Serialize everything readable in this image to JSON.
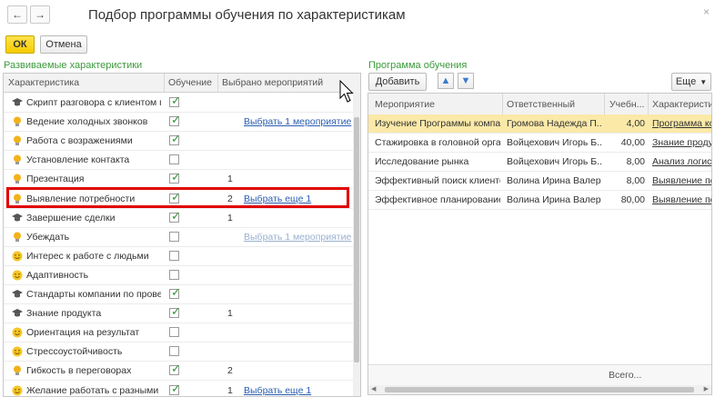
{
  "window": {
    "title": "Подбор программы обучения по характеристикам"
  },
  "toolbar": {
    "ok_label": "ОК",
    "cancel_label": "Отмена"
  },
  "left": {
    "section_title": "Развиваемые характеристики",
    "columns": [
      "Характеристика",
      "Обучение",
      "Выбрано мероприятий"
    ],
    "rows": [
      {
        "icon": "graduation-cap-icon",
        "name": "Скрипт разговора с клиентом п...",
        "training": true,
        "count": "",
        "link": ""
      },
      {
        "icon": "bulb-icon",
        "name": "Ведение холодных звонков",
        "training": true,
        "count": "",
        "link": "Выбрать 1 мероприятие"
      },
      {
        "icon": "bulb-icon",
        "name": "Работа с возражениями",
        "training": true,
        "count": "",
        "link": ""
      },
      {
        "icon": "bulb-icon",
        "name": "Установление контакта",
        "training": false,
        "count": "",
        "link": ""
      },
      {
        "icon": "bulb-icon",
        "name": "Презентация",
        "training": true,
        "count": "1",
        "link": ""
      },
      {
        "icon": "bulb-icon",
        "name": "Выявление потребности",
        "training": true,
        "count": "2",
        "link": "Выбрать еще 1"
      },
      {
        "icon": "graduation-cap-icon",
        "name": "Завершение сделки",
        "training": true,
        "count": "1",
        "link": ""
      },
      {
        "icon": "bulb-icon",
        "name": "Убеждать",
        "training": false,
        "count": "",
        "link": "Выбрать 1 мероприятие"
      },
      {
        "icon": "smiley-icon",
        "name": "Интерес к работе с людьми",
        "training": false,
        "count": "",
        "link": ""
      },
      {
        "icon": "smiley-icon",
        "name": "Адаптивность",
        "training": false,
        "count": "",
        "link": ""
      },
      {
        "icon": "graduation-cap-icon",
        "name": "Стандарты компании по прове...",
        "training": true,
        "count": "",
        "link": ""
      },
      {
        "icon": "graduation-cap-icon",
        "name": "Знание продукта",
        "training": true,
        "count": "1",
        "link": ""
      },
      {
        "icon": "smiley-icon",
        "name": "Ориентация на результат",
        "training": false,
        "count": "",
        "link": ""
      },
      {
        "icon": "smiley-icon",
        "name": "Стрессоустойчивость",
        "training": false,
        "count": "",
        "link": ""
      },
      {
        "icon": "bulb-icon",
        "name": "Гибкость в переговорах",
        "training": true,
        "count": "2",
        "link": ""
      },
      {
        "icon": "smiley-icon",
        "name": "Желание работать с разными к...",
        "training": true,
        "count": "1",
        "link": "Выбрать еще 1"
      }
    ]
  },
  "right": {
    "section_title": "Программа обучения",
    "add_label": "Добавить",
    "more_label": "Еще",
    "columns": [
      "Мероприятие",
      "Ответственный",
      "Учебн...",
      "Характеристи"
    ],
    "rows": [
      {
        "event": "Изучение Программы компа...",
        "owner": "Громова Надежда П...",
        "hours": "4,00",
        "char": "Программа комп"
      },
      {
        "event": "Стажировка в головной орга...",
        "owner": "Войцехович Игорь Б...",
        "hours": "40,00",
        "char": "Знание продукт"
      },
      {
        "event": "Исследование рынка",
        "owner": "Войцехович Игорь Б...",
        "hours": "8,00",
        "char": "Анализ логисти"
      },
      {
        "event": "Эффективный поиск клиентов",
        "owner": "Волина Ирина Валер...",
        "hours": "8,00",
        "char": "Выявление потр"
      },
      {
        "event": "Эффективное планирование ...",
        "owner": "Волина Ирина Валер...",
        "hours": "80,00",
        "char": "Выявление потр"
      }
    ],
    "footer_total": "Всего..."
  },
  "colors": {
    "accent_green": "#3b9a3b",
    "ok_yellow": "#f5cc00",
    "highlight_red": "#e00000",
    "selected_row": "#fbe9a8",
    "link_blue": "#2b5eb0"
  }
}
